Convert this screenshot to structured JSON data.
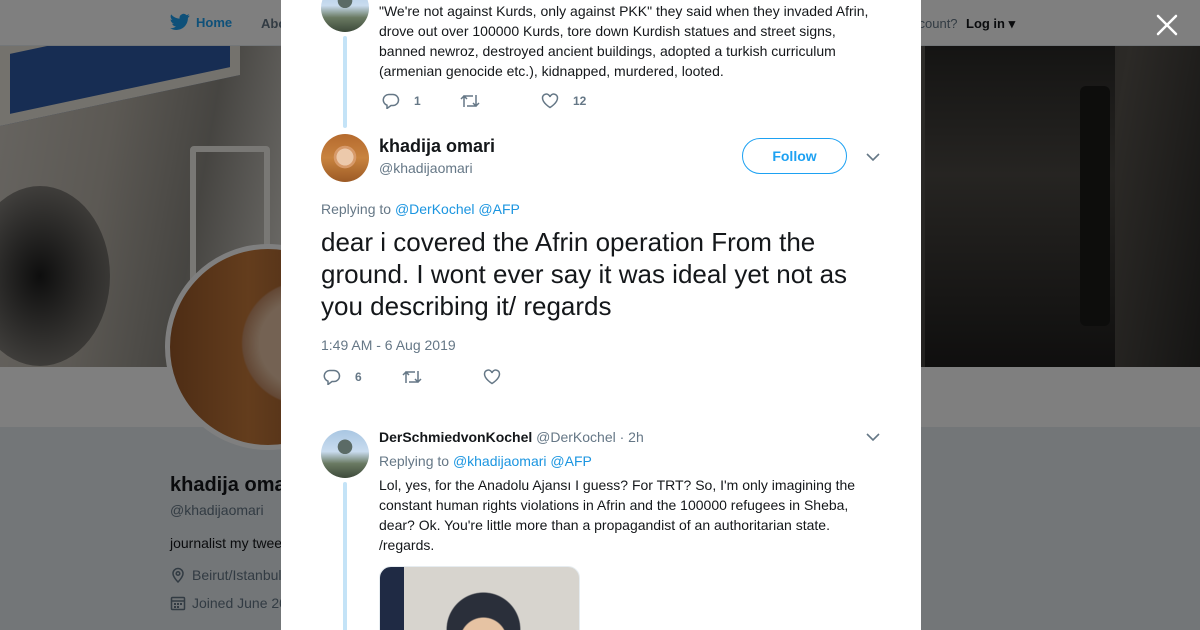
{
  "nav": {
    "home_label": "Home",
    "about_label": "Abo",
    "account_text": "ccount?",
    "login_label": "Log in"
  },
  "profile": {
    "name": "khadija oma",
    "handle": "@khadijaomari",
    "bio": "journalist my twee",
    "location": "Beirut/Istanbul",
    "joined": "Joined June 20"
  },
  "prev_tweet": {
    "text": "\"We're not against Kurds, only against PKK\" they said when they invaded Afrin, drove out over 100000 Kurds, tore down Kurdish statues and street signs, banned newroz, destroyed ancient buildings, adopted a turkish curriculum (armenian genocide etc.), kidnapped, murdered, looted.",
    "reply_count": "1",
    "like_count": "12"
  },
  "main_tweet": {
    "name": "khadija omari",
    "handle": "@khadijaomari",
    "follow_label": "Follow",
    "replying_to_label": "Replying to",
    "mention_1": "@DerKochel",
    "mention_2": "@AFP",
    "text": "dear i covered the Afrin operation From the ground. I wont ever say it was ideal yet not as you describing it/ regards",
    "timestamp": "1:49 AM - 6 Aug 2019",
    "reply_count": "6"
  },
  "reply_tweet": {
    "name": "DerSchmiedvonKochel",
    "handle": "@DerKochel",
    "time": "· 2h",
    "replying_to_label": "Replying to",
    "mention_1": "@khadijaomari",
    "mention_2": "@AFP",
    "text": "Lol, yes, for the Anadolu Ajansı I guess? For TRT?  So, I'm only imagining the constant human rights violations in Afrin and the 100000 refugees in Sheba, dear? Ok. You're little more than a propagandist of an authoritarian state. /regards."
  },
  "colors": {
    "brand_blue": "#1da1f2",
    "mention_blue": "#1b95e0",
    "thread_line": "#c4e3f7",
    "muted_text": "#657786",
    "primary_text": "#14171a",
    "overlay": "rgba(0,0,0,0.5)"
  },
  "icons": {
    "bird": "twitter-bird-icon",
    "close": "close-icon",
    "reply": "reply-icon",
    "retweet": "retweet-icon",
    "like": "heart-icon",
    "caret": "chevron-down-icon",
    "location": "location-icon",
    "calendar": "calendar-icon"
  }
}
